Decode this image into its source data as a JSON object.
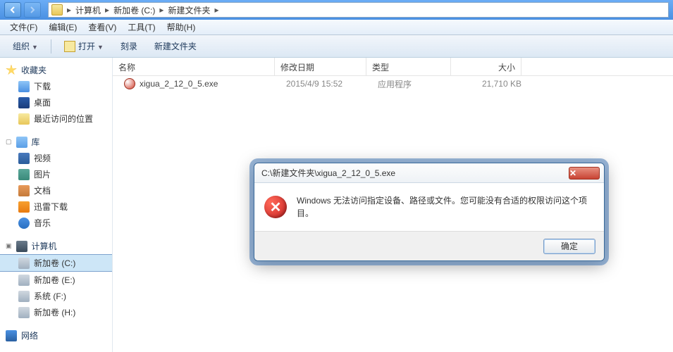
{
  "breadcrumb": {
    "seg1": "计算机",
    "seg2": "新加卷 (C:)",
    "seg3": "新建文件夹"
  },
  "menu": {
    "file": "文件(F)",
    "edit": "编辑(E)",
    "view": "查看(V)",
    "tools": "工具(T)",
    "help": "帮助(H)"
  },
  "toolbar": {
    "organize": "组织",
    "open": "打开",
    "burn": "刻录",
    "newfolder": "新建文件夹"
  },
  "sidebar": {
    "favorites": {
      "label": "收藏夹",
      "items": [
        {
          "label": "下载"
        },
        {
          "label": "桌面"
        },
        {
          "label": "最近访问的位置"
        }
      ]
    },
    "libraries": {
      "label": "库",
      "items": [
        {
          "label": "视频"
        },
        {
          "label": "图片"
        },
        {
          "label": "文档"
        },
        {
          "label": "迅雷下载"
        },
        {
          "label": "音乐"
        }
      ]
    },
    "computer": {
      "label": "计算机",
      "items": [
        {
          "label": "新加卷 (C:)"
        },
        {
          "label": "新加卷 (E:)"
        },
        {
          "label": "系统 (F:)"
        },
        {
          "label": "新加卷 (H:)"
        }
      ]
    },
    "network": {
      "label": "网络"
    }
  },
  "columns": {
    "name": "名称",
    "date": "修改日期",
    "type": "类型",
    "size": "大小"
  },
  "files": [
    {
      "name": "xigua_2_12_0_5.exe",
      "date": "2015/4/9 15:52",
      "type": "应用程序",
      "size": "21,710 KB"
    }
  ],
  "dialog": {
    "title": "C:\\新建文件夹\\xigua_2_12_0_5.exe",
    "message": "Windows 无法访问指定设备、路径或文件。您可能没有合适的权限访问这个项目。",
    "ok": "确定"
  }
}
